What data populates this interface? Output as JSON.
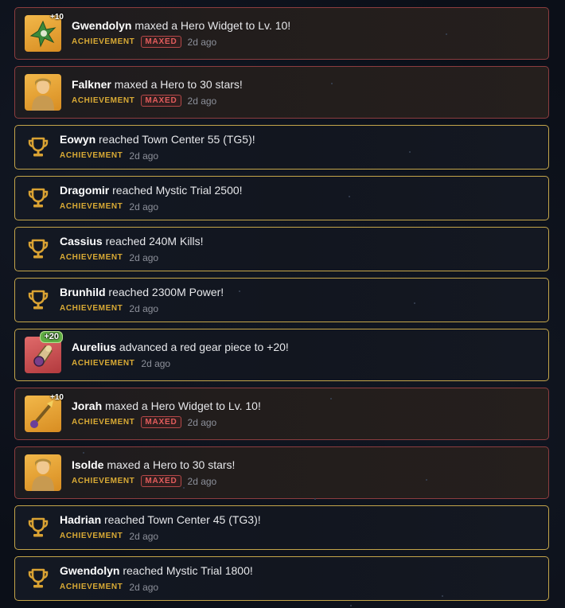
{
  "feed": [
    {
      "kind": "image",
      "variant": "red",
      "thumb_bg": "gold",
      "thumb_icon": "widget-leaf-icon",
      "badge": "+10",
      "name": "Gwendolyn",
      "action": " maxed a Hero Widget to Lv. 10!",
      "tag": "ACHIEVEMENT",
      "maxed": "MAXED",
      "time": "2d ago"
    },
    {
      "kind": "image",
      "variant": "red",
      "thumb_bg": "gold",
      "thumb_icon": "hero-portrait-icon",
      "badge": "",
      "name": "Falkner",
      "action": " maxed a Hero to 30 stars!",
      "tag": "ACHIEVEMENT",
      "maxed": "MAXED",
      "time": "2d ago"
    },
    {
      "kind": "trophy",
      "variant": "gold",
      "name": "Eowyn",
      "action": " reached Town Center 55 (TG5)!",
      "tag": "ACHIEVEMENT",
      "time": "2d ago"
    },
    {
      "kind": "trophy",
      "variant": "gold",
      "name": "Dragomir",
      "action": " reached Mystic Trial 2500!",
      "tag": "ACHIEVEMENT",
      "time": "2d ago"
    },
    {
      "kind": "trophy",
      "variant": "gold",
      "name": "Cassius",
      "action": " reached 240M Kills!",
      "tag": "ACHIEVEMENT",
      "time": "2d ago"
    },
    {
      "kind": "trophy",
      "variant": "gold",
      "name": "Brunhild",
      "action": " reached 2300M Power!",
      "tag": "ACHIEVEMENT",
      "time": "2d ago"
    },
    {
      "kind": "image",
      "variant": "gold",
      "thumb_bg": "red",
      "thumb_icon": "gear-gauntlet-icon",
      "badge": "+20",
      "name": "Aurelius",
      "action": " advanced a red gear piece to +20!",
      "tag": "ACHIEVEMENT",
      "time": "2d ago"
    },
    {
      "kind": "image",
      "variant": "red",
      "thumb_bg": "gold",
      "thumb_icon": "widget-staff-icon",
      "badge": "+10",
      "name": "Jorah",
      "action": " maxed a Hero Widget to Lv. 10!",
      "tag": "ACHIEVEMENT",
      "maxed": "MAXED",
      "time": "2d ago"
    },
    {
      "kind": "image",
      "variant": "red",
      "thumb_bg": "gold",
      "thumb_icon": "hero-portrait-icon",
      "badge": "",
      "name": "Isolde",
      "action": " maxed a Hero to 30 stars!",
      "tag": "ACHIEVEMENT",
      "maxed": "MAXED",
      "time": "2d ago"
    },
    {
      "kind": "trophy",
      "variant": "gold",
      "name": "Hadrian",
      "action": " reached Town Center 45 (TG3)!",
      "tag": "ACHIEVEMENT",
      "time": "2d ago"
    },
    {
      "kind": "trophy",
      "variant": "gold",
      "name": "Gwendolyn",
      "action": " reached Mystic Trial 1800!",
      "tag": "ACHIEVEMENT",
      "time": "2d ago"
    }
  ],
  "colors": {
    "accent_gold": "#d9aa35",
    "maxed_red": "#e25c5c",
    "border_gold": "#c4a54a",
    "border_red": "#8c3d3f"
  }
}
